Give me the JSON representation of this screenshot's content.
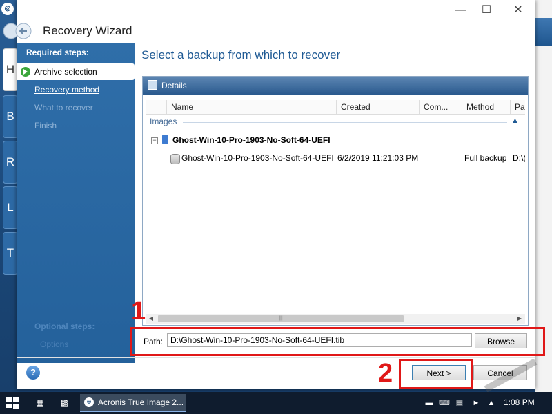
{
  "window": {
    "title": "Recovery Wizard"
  },
  "sidebar": {
    "required_label": "Required steps:",
    "steps": [
      {
        "label": "Archive selection",
        "state": "current"
      },
      {
        "label": "Recovery method",
        "state": "link"
      },
      {
        "label": "What to recover",
        "state": "disabled"
      },
      {
        "label": "Finish",
        "state": "disabled"
      }
    ],
    "optional_label": "Optional steps:",
    "optional_items": [
      "Options"
    ]
  },
  "main": {
    "heading": "Select a backup from which to recover",
    "panel_title": "Details",
    "columns": [
      "Name",
      "Created",
      "Com...",
      "Method",
      "Pa"
    ],
    "group_label": "Images",
    "node": {
      "toggle": "−",
      "name": "Ghost-Win-10-Pro-1903-No-Soft-64-UEFI"
    },
    "rows": [
      {
        "name": "Ghost-Win-10-Pro-1903-No-Soft-64-UEFI",
        "created": "6/2/2019 11:21:03 PM",
        "comment": "",
        "method": "Full backup",
        "path": "D:\\("
      }
    ],
    "scroll_grip": "|||"
  },
  "path_row": {
    "label": "Path:",
    "value": "D:\\Ghost-Win-10-Pro-1903-No-Soft-64-UEFI.tib",
    "browse_label": "Browse"
  },
  "footer": {
    "help_icon_glyph": "?",
    "next_label": "Next >",
    "cancel_label": "Cancel"
  },
  "annotations": {
    "label_1": "1",
    "label_2": "2",
    "color": "#e01818"
  },
  "background_app": {
    "tiles": [
      "H",
      "B",
      "R",
      "L",
      "T"
    ]
  },
  "taskbar": {
    "task_label": "Acronis True Image 2...",
    "clock": "1:08 PM"
  },
  "colors": {
    "sidebar": "#2f6ea9",
    "heading": "#1f5a94",
    "panel_header": "#2a5a8e",
    "taskbar": "#0f1c2e"
  }
}
